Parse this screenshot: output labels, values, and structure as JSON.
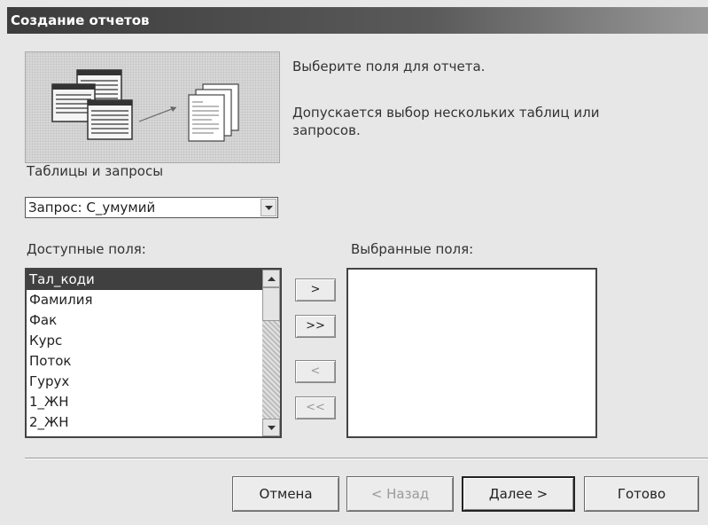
{
  "window": {
    "title": "Создание отчетов"
  },
  "intro": {
    "line1": "Выберите поля для отчета.",
    "line2": "Допускается выбор нескольких таблиц или запросов."
  },
  "tables_label": "Таблицы и запросы",
  "tables_combo": {
    "value": "Запрос: С_умумий"
  },
  "available_label": "Доступные поля:",
  "selected_label": "Выбранные поля:",
  "available_fields": [
    "Тал_коди",
    "Фамилия",
    "Фак",
    "Курс",
    "Поток",
    "Гурух",
    "1_ЖН",
    "2_ЖН"
  ],
  "selected_index": 0,
  "selected_fields": [],
  "move_buttons": {
    "add_one": ">",
    "add_all": ">>",
    "remove_one": "<",
    "remove_all": "<<"
  },
  "buttons": {
    "cancel": "Отмена",
    "back": "< Назад",
    "next": "Далее >",
    "finish": "Готово"
  },
  "icons": [
    "tables-icon",
    "arrow-icon",
    "report-pages-icon",
    "dropdown-arrow-icon",
    "scroll-up-icon",
    "scroll-down-icon"
  ]
}
